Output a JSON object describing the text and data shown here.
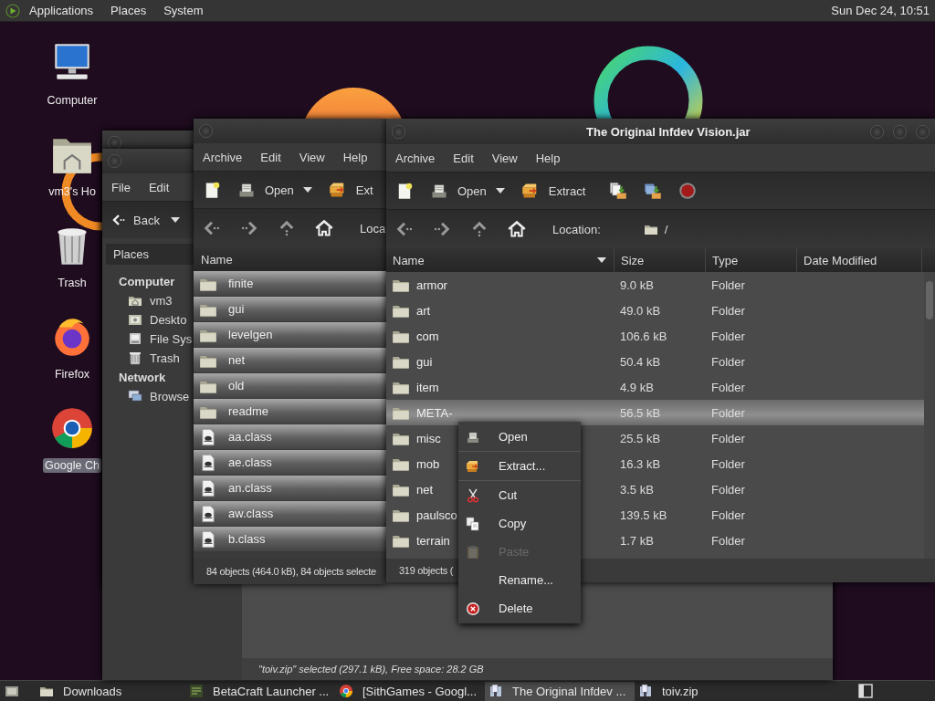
{
  "top_panel": {
    "menus": [
      "Applications",
      "Places",
      "System"
    ],
    "clock": "Sun Dec 24, 10:51"
  },
  "desktop_icons": [
    {
      "label": "Computer",
      "kind": "computer",
      "selected": false
    },
    {
      "label": "vm3's Ho",
      "kind": "home",
      "selected": false
    },
    {
      "label": "Trash",
      "kind": "trash",
      "selected": false
    },
    {
      "label": "Firefox",
      "kind": "firefox",
      "selected": false
    },
    {
      "label": "Google Ch",
      "kind": "chrome",
      "selected": true
    }
  ],
  "file_manager": {
    "menus": [
      "File",
      "Edit"
    ],
    "back_button": "Back",
    "sidebar": {
      "title": "Places",
      "sections": [
        {
          "heading": "Computer",
          "items": [
            {
              "label": "vm3",
              "kind": "home"
            },
            {
              "label": "Deskto",
              "kind": "desktop"
            },
            {
              "label": "File Sys",
              "kind": "drive"
            },
            {
              "label": "Trash",
              "kind": "trash"
            }
          ]
        },
        {
          "heading": "Network",
          "items": [
            {
              "label": "Browse",
              "kind": "network"
            }
          ]
        }
      ]
    },
    "status_bar": "\"toiv.zip\" selected (297.1 kB), Free space: 28.2 GB"
  },
  "archive_window_behind": {
    "menus": [
      "Archive",
      "Edit",
      "View",
      "Help"
    ],
    "toolbar": {
      "open": "Open",
      "extract": "Ext"
    },
    "location_label": "Loca",
    "columns": [
      "Name"
    ],
    "rows": [
      {
        "name": "finite",
        "kind": "folder",
        "selected": true
      },
      {
        "name": "gui",
        "kind": "folder",
        "selected": true
      },
      {
        "name": "levelgen",
        "kind": "folder",
        "selected": true
      },
      {
        "name": "net",
        "kind": "folder",
        "selected": true
      },
      {
        "name": "old",
        "kind": "folder",
        "selected": true
      },
      {
        "name": "readme",
        "kind": "folder",
        "selected": true
      },
      {
        "name": "aa.class",
        "kind": "class",
        "selected": true
      },
      {
        "name": "ae.class",
        "kind": "class",
        "selected": true
      },
      {
        "name": "an.class",
        "kind": "class",
        "selected": true
      },
      {
        "name": "aw.class",
        "kind": "class",
        "selected": true
      },
      {
        "name": "b.class",
        "kind": "class",
        "selected": true
      }
    ],
    "status_bar": "84 objects (464.0 kB), 84 objects selecte"
  },
  "archive_window": {
    "title": "The Original Infdev Vision.jar",
    "menus": [
      "Archive",
      "Edit",
      "View",
      "Help"
    ],
    "toolbar": {
      "open": "Open",
      "extract": "Extract"
    },
    "location_label": "Location:",
    "location": "/",
    "columns": [
      {
        "label": "Name",
        "sorted": true
      },
      {
        "label": "Size",
        "sorted": false
      },
      {
        "label": "Type",
        "sorted": false
      },
      {
        "label": "Date Modified",
        "sorted": false
      }
    ],
    "rows": [
      {
        "name": "armor",
        "size": "9.0 kB",
        "type": "Folder",
        "selected": false
      },
      {
        "name": "art",
        "size": "49.0 kB",
        "type": "Folder",
        "selected": false
      },
      {
        "name": "com",
        "size": "106.6 kB",
        "type": "Folder",
        "selected": false
      },
      {
        "name": "gui",
        "size": "50.4 kB",
        "type": "Folder",
        "selected": false
      },
      {
        "name": "item",
        "size": "4.9 kB",
        "type": "Folder",
        "selected": false
      },
      {
        "name": "META-",
        "size": "56.5 kB",
        "type": "Folder",
        "selected": true
      },
      {
        "name": "misc",
        "size": "25.5 kB",
        "type": "Folder",
        "selected": false
      },
      {
        "name": "mob",
        "size": "16.3 kB",
        "type": "Folder",
        "selected": false
      },
      {
        "name": "net",
        "size": "3.5 kB",
        "type": "Folder",
        "selected": false
      },
      {
        "name": "paulsco",
        "size": "139.5 kB",
        "type": "Folder",
        "selected": false
      },
      {
        "name": "terrain",
        "size": "1.7 kB",
        "type": "Folder",
        "selected": false
      }
    ],
    "status_bar": "319 objects ("
  },
  "context_menu": [
    {
      "label": "Open",
      "kind": "open",
      "disabled": false,
      "separator_after": true
    },
    {
      "label": "Extract...",
      "kind": "extract",
      "disabled": false,
      "separator_after": true
    },
    {
      "label": "Cut",
      "kind": "cut",
      "disabled": false,
      "separator_after": false
    },
    {
      "label": "Copy",
      "kind": "copy",
      "disabled": false,
      "separator_after": false
    },
    {
      "label": "Paste",
      "kind": "paste",
      "disabled": true,
      "separator_after": false
    },
    {
      "label": "Rename...",
      "kind": "none",
      "disabled": false,
      "separator_after": false
    },
    {
      "label": "Delete",
      "kind": "delete",
      "disabled": false,
      "separator_after": false
    }
  ],
  "taskbar": [
    {
      "label": "Downloads",
      "kind": "folder",
      "selected": false
    },
    {
      "label": "BetaCraft Launcher ...",
      "kind": "app",
      "selected": false
    },
    {
      "label": "[SithGames - Googl...",
      "kind": "chrome",
      "selected": false
    },
    {
      "label": "The Original Infdev ...",
      "kind": "archive",
      "selected": true
    },
    {
      "label": "toiv.zip",
      "kind": "archive",
      "selected": false
    }
  ]
}
